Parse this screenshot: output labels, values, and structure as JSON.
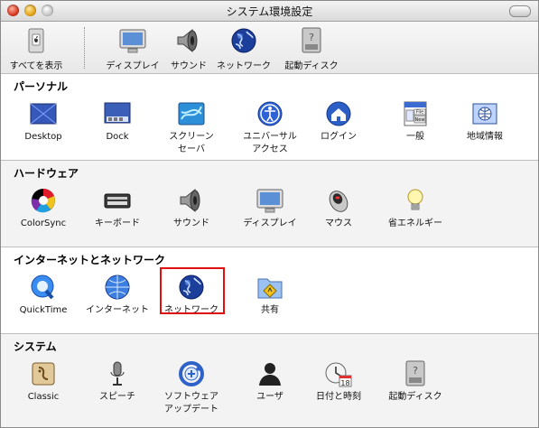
{
  "window": {
    "title": "システム環境設定"
  },
  "toolbar": {
    "items": [
      {
        "label": "すべてを表示",
        "icon": "apple-light-switch-icon"
      },
      {
        "label": "ディスプレイ",
        "icon": "display-icon"
      },
      {
        "label": "サウンド",
        "icon": "speaker-icon"
      },
      {
        "label": "ネットワーク",
        "icon": "globe-icon"
      },
      {
        "label": "起動ディスク",
        "icon": "hard-disk-icon"
      }
    ]
  },
  "sections": [
    {
      "title": "パーソナル",
      "items": [
        {
          "label": "Desktop",
          "icon": "desktop-icon"
        },
        {
          "label": "Dock",
          "icon": "dock-icon"
        },
        {
          "label": "スクリーン\nセーバ",
          "icon": "screensaver-icon"
        },
        {
          "label": "ユニバーサル\nアクセス",
          "icon": "universal-access-icon"
        },
        {
          "label": "ログイン",
          "icon": "login-house-icon"
        },
        {
          "label": "一般",
          "icon": "general-icon"
        },
        {
          "label": "地域情報",
          "icon": "international-flag-icon"
        }
      ]
    },
    {
      "title": "ハードウェア",
      "items": [
        {
          "label": "ColorSync",
          "icon": "colorsync-icon"
        },
        {
          "label": "キーボード",
          "icon": "keyboard-icon"
        },
        {
          "label": "サウンド",
          "icon": "speaker-icon"
        },
        {
          "label": "ディスプレイ",
          "icon": "display-icon"
        },
        {
          "label": "マウス",
          "icon": "mouse-icon"
        },
        {
          "label": "省エネルギー",
          "icon": "lightbulb-icon"
        }
      ]
    },
    {
      "title": "インターネットとネットワーク",
      "items": [
        {
          "label": "QuickTime",
          "icon": "quicktime-icon"
        },
        {
          "label": "インターネット",
          "icon": "internet-icon"
        },
        {
          "label": "ネットワーク",
          "icon": "globe-icon",
          "selected": true
        },
        {
          "label": "共有",
          "icon": "sharing-folder-icon"
        }
      ]
    },
    {
      "title": "システム",
      "items": [
        {
          "label": "Classic",
          "icon": "classic-icon"
        },
        {
          "label": "スピーチ",
          "icon": "microphone-icon"
        },
        {
          "label": "ソフトウェア\nアップデート",
          "icon": "software-update-icon"
        },
        {
          "label": "ユーザ",
          "icon": "user-silhouette-icon"
        },
        {
          "label": "日付と時刻",
          "icon": "clock-calendar-icon"
        },
        {
          "label": "起動ディスク",
          "icon": "hard-disk-icon"
        }
      ]
    }
  ],
  "calendar_day": "18",
  "general_icon_text": [
    "File",
    "New"
  ]
}
